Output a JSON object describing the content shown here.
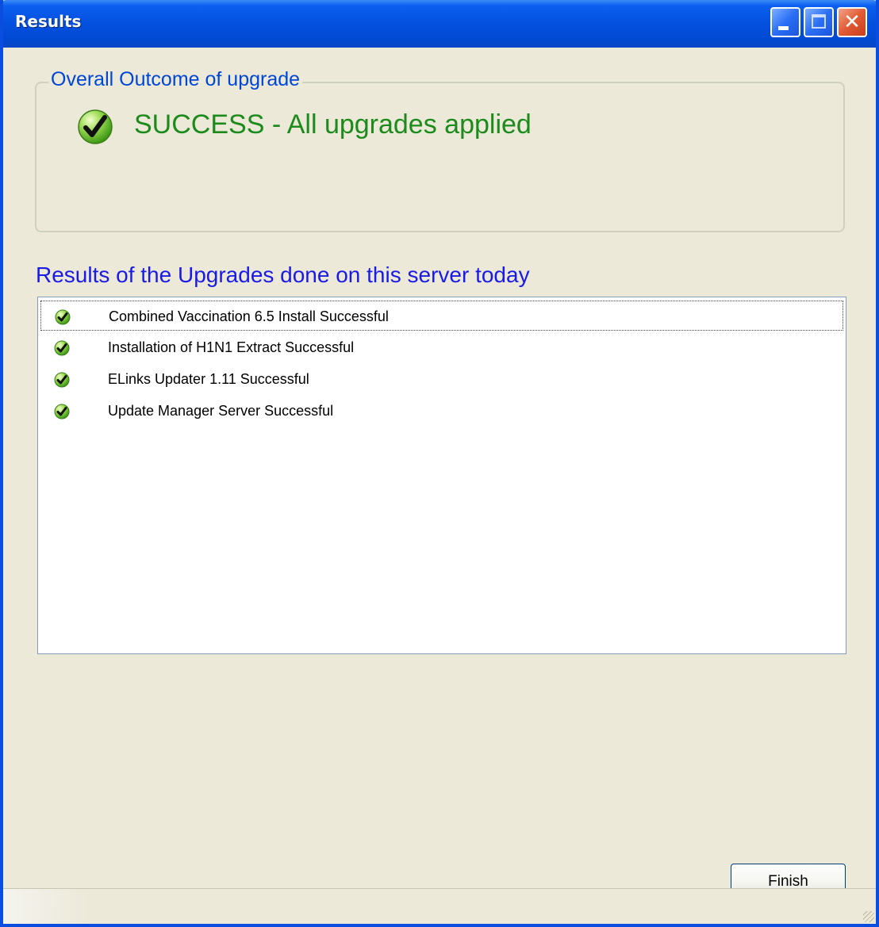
{
  "window": {
    "title": "Results"
  },
  "outcome": {
    "group_label": "Overall Outcome of upgrade",
    "status_text": "SUCCESS - All upgrades applied",
    "status_icon": "green-checkmark-icon",
    "status_color": "#1c8b1c"
  },
  "results": {
    "heading": "Results of the Upgrades done on this server today",
    "items": [
      {
        "label": "Combined Vaccination 6.5 Install Successful",
        "icon": "green-checkmark-icon",
        "focused": true
      },
      {
        "label": "Installation of H1N1 Extract Successful",
        "icon": "green-checkmark-icon",
        "focused": false
      },
      {
        "label": "ELinks Updater 1.11 Successful",
        "icon": "green-checkmark-icon",
        "focused": false
      },
      {
        "label": "Update Manager Server Successful",
        "icon": "green-checkmark-icon",
        "focused": false
      }
    ]
  },
  "footer": {
    "finish_label": "Finish"
  },
  "colors": {
    "titlebar": "#0552e1",
    "group_label": "#0046d5",
    "heading": "#1a1ae6",
    "success": "#1c8b1c"
  }
}
